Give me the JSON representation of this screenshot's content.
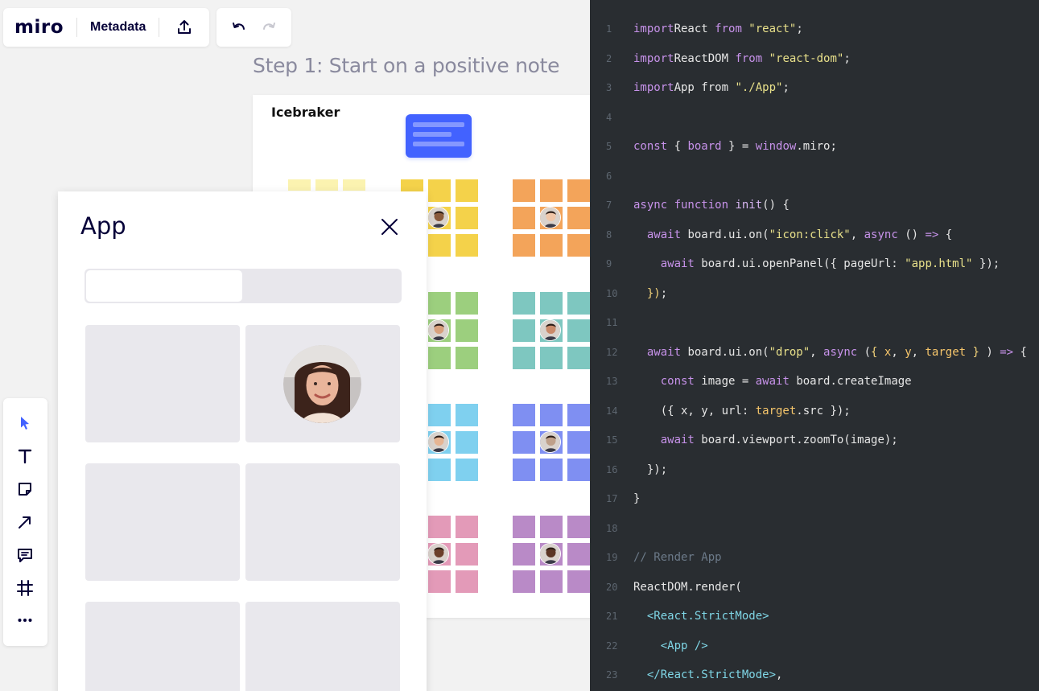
{
  "topbar": {
    "logo": "miro",
    "board_name": "Metadata",
    "share_icon": "upload-icon",
    "undo_icon": "undo-icon",
    "redo_icon": "redo-icon"
  },
  "canvas": {
    "step_title": "Step 1: Start on a positive note",
    "frame_title": "Icebraker"
  },
  "app_panel": {
    "title": "App",
    "close_icon": "close-icon",
    "search": {
      "value": "",
      "placeholder": ""
    }
  },
  "toolbar": {
    "tools": [
      "select-tool",
      "text-tool",
      "sticky-note-tool",
      "arrow-tool",
      "comment-tool",
      "frame-tool",
      "more-tool"
    ]
  },
  "colors": {
    "accent": "#4262ff",
    "yellow_light": "#fbf3b0",
    "yellow": "#f4d24a",
    "orange": "#f3a45a",
    "green": "#9ccf7e",
    "teal": "#7ec7c0",
    "sky": "#7fd0ef",
    "periwinkle": "#7f8ff2",
    "pink": "#e39ab8",
    "purple": "#b98ac7",
    "editor_bg": "#292d31"
  },
  "code": {
    "lines": [
      {
        "n": "1",
        "parts": [
          [
            "kw",
            "import"
          ],
          [
            "",
            "React "
          ],
          [
            "kw",
            "from"
          ],
          [
            "str",
            " \"react\""
          ],
          [
            "",
            ";"
          ]
        ]
      },
      {
        "n": "2",
        "parts": [
          [
            "kw",
            "import"
          ],
          [
            "",
            "ReactDOM "
          ],
          [
            "kw",
            "from"
          ],
          [
            "str",
            " \"react-dom\""
          ],
          [
            "",
            ";"
          ]
        ]
      },
      {
        "n": "3",
        "parts": [
          [
            "kw",
            "import"
          ],
          [
            "",
            "App from "
          ],
          [
            "str",
            "\"./App\""
          ],
          [
            "",
            ";"
          ]
        ]
      },
      {
        "n": "4",
        "parts": []
      },
      {
        "n": "5",
        "parts": [
          [
            "kw",
            "const"
          ],
          [
            "",
            " { "
          ],
          [
            "prop",
            "board"
          ],
          [
            "",
            " } = "
          ],
          [
            "kw",
            "window"
          ],
          [
            "",
            ".miro;"
          ]
        ]
      },
      {
        "n": "6",
        "parts": []
      },
      {
        "n": "7",
        "parts": [
          [
            "kw",
            "async function"
          ],
          [
            "fn",
            " init"
          ],
          [
            "",
            "() {"
          ]
        ]
      },
      {
        "n": "8",
        "parts": [
          [
            "",
            "  "
          ],
          [
            "kw",
            "await"
          ],
          [
            "",
            " board.ui.on("
          ],
          [
            "str",
            "\"icon:click\""
          ],
          [
            "",
            ", "
          ],
          [
            "kw",
            "async"
          ],
          [
            "",
            " () "
          ],
          [
            "kw",
            "=>"
          ],
          [
            "",
            " {"
          ]
        ]
      },
      {
        "n": "9",
        "parts": [
          [
            "",
            "    "
          ],
          [
            "kw",
            "await"
          ],
          [
            "",
            " board.ui.openPanel({ pageUrl: "
          ],
          [
            "str",
            "\"app.html\""
          ],
          [
            "",
            " });"
          ]
        ]
      },
      {
        "n": "10",
        "parts": [
          [
            "",
            "  "
          ],
          [
            "brace",
            "})"
          ],
          [
            "",
            ";"
          ]
        ]
      },
      {
        "n": "11",
        "parts": []
      },
      {
        "n": "12",
        "parts": [
          [
            "",
            "  "
          ],
          [
            "kw",
            "await"
          ],
          [
            "",
            " board.ui.on("
          ],
          [
            "str",
            "\"drop\""
          ],
          [
            "",
            ", "
          ],
          [
            "kw",
            "async"
          ],
          [
            "",
            " ("
          ],
          [
            "brace",
            "{"
          ],
          [
            "var",
            " x"
          ],
          [
            "",
            ", "
          ],
          [
            "var",
            "y"
          ],
          [
            "",
            ", "
          ],
          [
            "var",
            "target"
          ],
          [
            "brace",
            " }"
          ],
          [
            "",
            " ) "
          ],
          [
            "kw",
            "=>"
          ],
          [
            "",
            " {"
          ]
        ]
      },
      {
        "n": "13",
        "parts": [
          [
            "",
            "    "
          ],
          [
            "kw",
            "const"
          ],
          [
            "",
            " image = "
          ],
          [
            "kw",
            "await"
          ],
          [
            "",
            " board.createImage"
          ]
        ]
      },
      {
        "n": "14",
        "parts": [
          [
            "",
            "    ({ x, y, url: "
          ],
          [
            "var",
            "target"
          ],
          [
            "",
            ".src });"
          ]
        ]
      },
      {
        "n": "15",
        "parts": [
          [
            "",
            "    "
          ],
          [
            "kw",
            "await"
          ],
          [
            "",
            " board.viewport.zoomTo(image);"
          ]
        ]
      },
      {
        "n": "16",
        "parts": [
          [
            "",
            "  });"
          ]
        ]
      },
      {
        "n": "17",
        "parts": [
          [
            "",
            "}"
          ]
        ]
      },
      {
        "n": "18",
        "parts": []
      },
      {
        "n": "19",
        "parts": [
          [
            "com",
            "// Render App"
          ]
        ]
      },
      {
        "n": "20",
        "parts": [
          [
            "",
            "ReactDOM.render("
          ]
        ]
      },
      {
        "n": "21",
        "parts": [
          [
            "",
            "  "
          ],
          [
            "tag",
            "<React.StrictMode>"
          ]
        ]
      },
      {
        "n": "22",
        "parts": [
          [
            "",
            "    "
          ],
          [
            "tag",
            "<App />"
          ]
        ]
      },
      {
        "n": "23",
        "parts": [
          [
            "",
            "  "
          ],
          [
            "tag",
            "</React.StrictMode>"
          ],
          [
            "",
            ","
          ]
        ]
      }
    ]
  }
}
